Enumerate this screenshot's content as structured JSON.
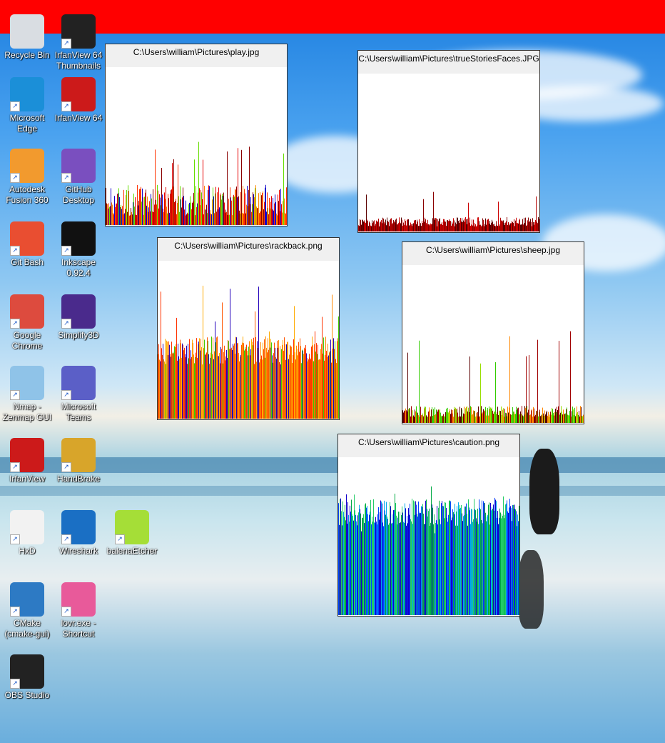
{
  "desktop": {
    "icons": [
      {
        "label": "Recycle Bin",
        "icon": "recycle-bin-icon",
        "color": "#d9dde2"
      },
      {
        "label": "IrfanView 64 Thumbnails",
        "icon": "irfanview-thumbnails-icon",
        "color": "#222222"
      },
      {
        "label": "Microsoft Edge",
        "icon": "edge-icon",
        "color": "#1b8fd8"
      },
      {
        "label": "IrfanView 64",
        "icon": "irfanview-64-icon",
        "color": "#cc1a1a"
      },
      {
        "label": "Autodesk Fusion 360",
        "icon": "fusion360-icon",
        "color": "#f29a2e"
      },
      {
        "label": "GitHub Desktop",
        "icon": "github-desktop-icon",
        "color": "#7a4fbf"
      },
      {
        "label": "Git Bash",
        "icon": "git-bash-icon",
        "color": "#e94e31"
      },
      {
        "label": "Inkscape 0.92.4",
        "icon": "inkscape-icon",
        "color": "#111111"
      },
      {
        "label": "Google Chrome",
        "icon": "chrome-icon",
        "color": "#dd4b3e"
      },
      {
        "label": "Simplify3D",
        "icon": "simplify3d-icon",
        "color": "#4a2a8c"
      },
      {
        "label": "Nmap - Zenmap GUI",
        "icon": "nmap-eye-icon",
        "color": "#8fc3e8"
      },
      {
        "label": "Microsoft Teams",
        "icon": "teams-icon",
        "color": "#5b5fc7"
      },
      {
        "label": "IrfanView",
        "icon": "irfanview-icon",
        "color": "#cc1a1a"
      },
      {
        "label": "HandBrake",
        "icon": "handbrake-icon",
        "color": "#d8a52a"
      },
      {
        "label": "HxD",
        "icon": "hxd-icon",
        "color": "#f2f2f2"
      },
      {
        "label": "Wireshark",
        "icon": "wireshark-icon",
        "color": "#1a6fc4"
      },
      {
        "label": "balenaEtcher",
        "icon": "balena-etcher-icon",
        "color": "#a5de37"
      },
      {
        "label": "CMake (cmake-gui)",
        "icon": "cmake-icon",
        "color": "#2d7ac4"
      },
      {
        "label": "lovr.exe - Shortcut",
        "icon": "lovr-icon",
        "color": "#e85a9a"
      },
      {
        "label": "OBS Studio",
        "icon": "obs-icon",
        "color": "#222222"
      }
    ]
  },
  "windows": [
    {
      "title": "C:\\Users\\william\\Pictures\\play.jpg",
      "palette": [
        "#8a0000",
        "#e60000",
        "#ff3300",
        "#ff8800",
        "#66dd00",
        "#1100cc"
      ]
    },
    {
      "title": "C:\\Users\\william\\Pictures\\trueStoriesFaces.JPG",
      "palette": [
        "#5a0000",
        "#8a0000",
        "#b30000",
        "#cc0000"
      ]
    },
    {
      "title": "C:\\Users\\william\\Pictures\\rackback.png",
      "palette": [
        "#ff3300",
        "#ff5500",
        "#ff8800",
        "#ffaa00",
        "#44cc00",
        "#2200bb"
      ]
    },
    {
      "title": "C:\\Users\\william\\Pictures\\sheep.jpg",
      "palette": [
        "#5a0000",
        "#a00000",
        "#ff8800",
        "#99dd00",
        "#33cc00"
      ]
    },
    {
      "title": "C:\\Users\\william\\Pictures\\caution.png",
      "palette": [
        "#00aa44",
        "#22cc66",
        "#00aaee",
        "#0044ff",
        "#1100cc"
      ]
    }
  ]
}
